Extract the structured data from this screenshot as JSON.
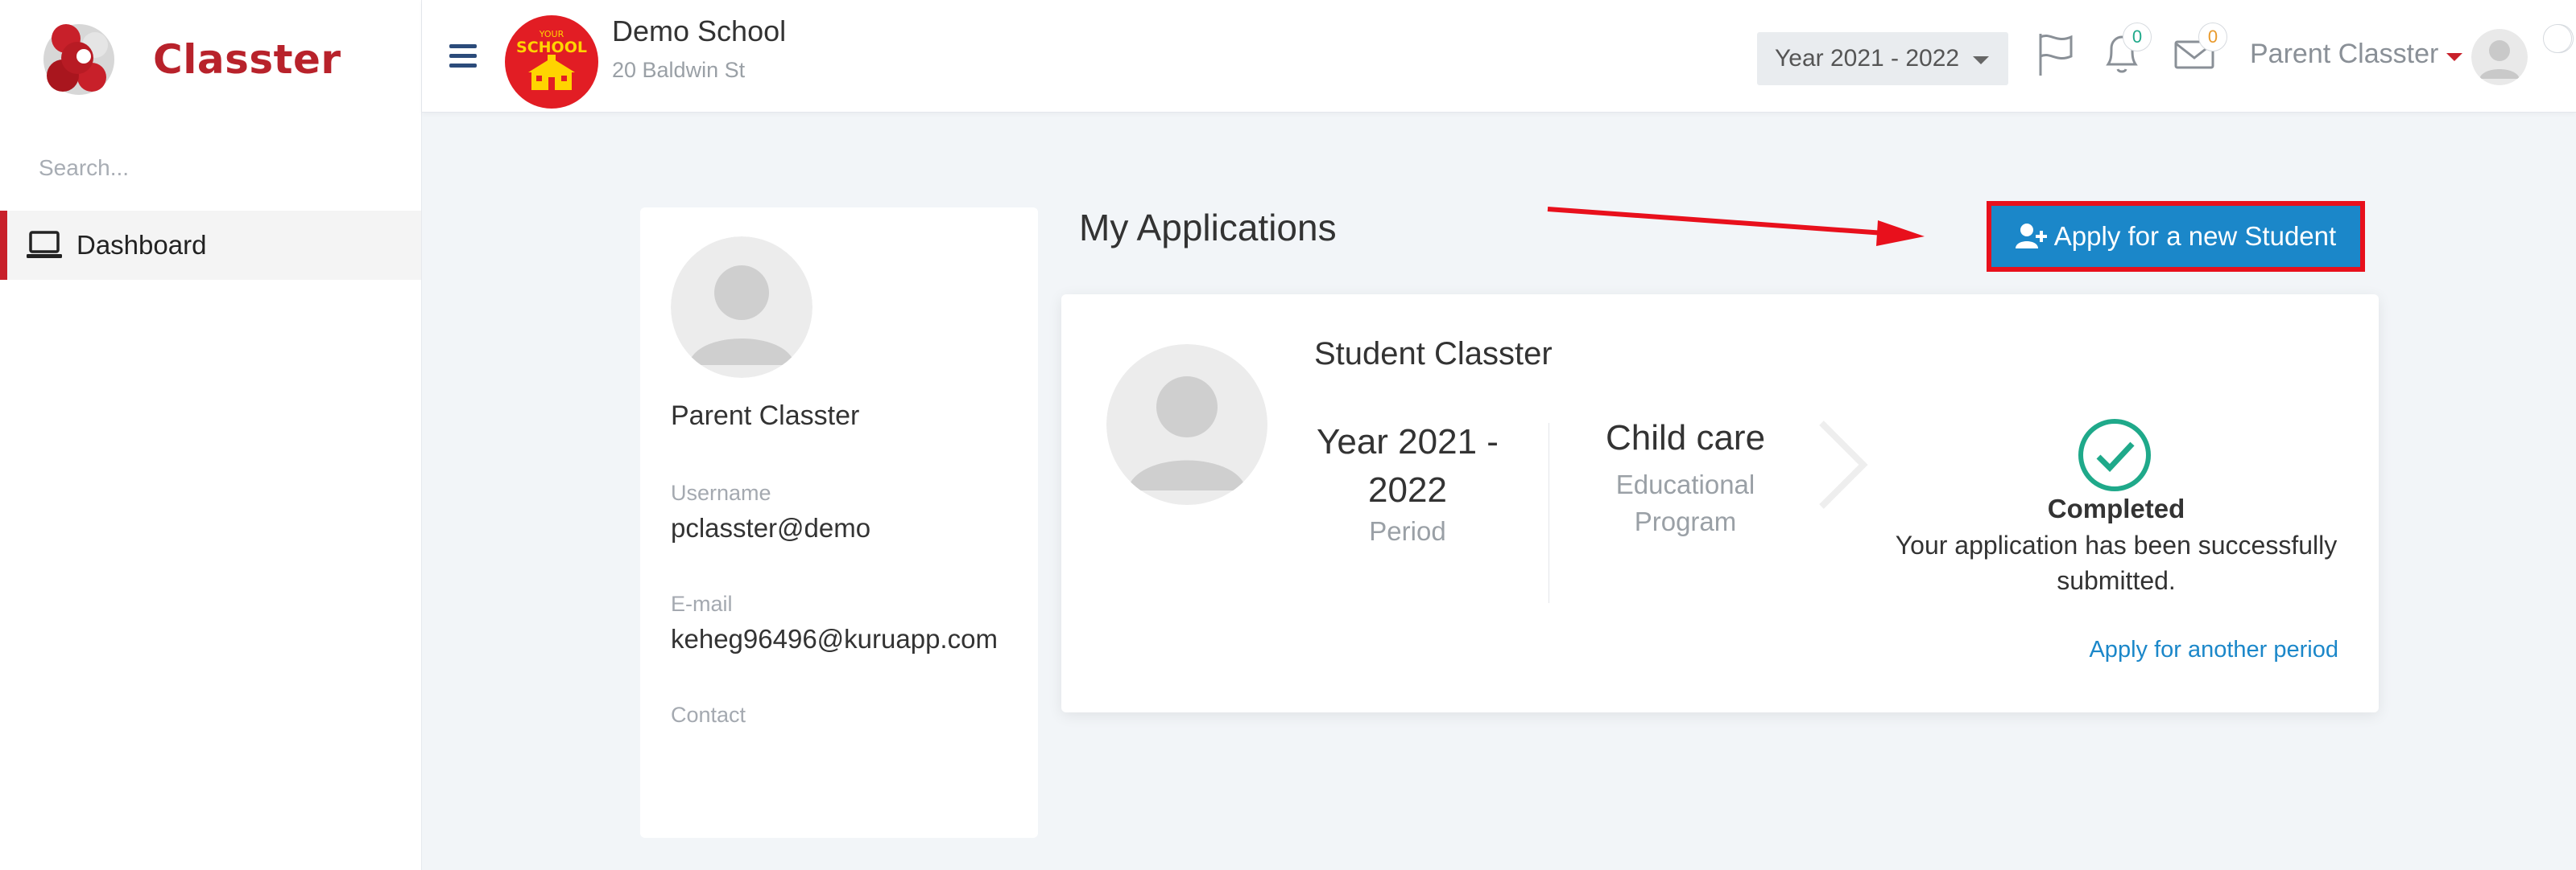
{
  "app": {
    "name": "Classter"
  },
  "sidebar": {
    "search_placeholder": "Search...",
    "items": [
      {
        "label": "Dashboard",
        "icon": "laptop-icon"
      }
    ]
  },
  "header": {
    "school_name": "Demo School",
    "school_address": "20 Baldwin St",
    "school_logo_text_top": "YOUR",
    "school_logo_text_bottom": "SCHOOL",
    "year_selector": "Year 2021 - 2022",
    "notifications_count": "0",
    "messages_count": "0",
    "user_name": "Parent Classter"
  },
  "profile": {
    "name": "Parent Classter",
    "username_label": "Username",
    "username": "pclasster@demo",
    "email_label": "E-mail",
    "email": "keheg96496@kuruapp.com",
    "contact_label": "Contact"
  },
  "applications": {
    "title": "My Applications",
    "apply_button": "Apply for a new Student",
    "student_name": "Student Classter",
    "period_value_line1": "Year 2021 -",
    "period_value_line2": "2022",
    "period_label": "Period",
    "program_value": "Child care",
    "program_label_line1": "Educational",
    "program_label_line2": "Program",
    "status_title": "Completed",
    "status_text_line1": "Your application has been successfully",
    "status_text_line2": "submitted.",
    "another_period_link": "Apply for another period"
  },
  "colors": {
    "brand_red": "#c8202a",
    "primary_blue": "#1b87c9",
    "success_green": "#1fa98a",
    "highlight_red": "#e8101c"
  }
}
